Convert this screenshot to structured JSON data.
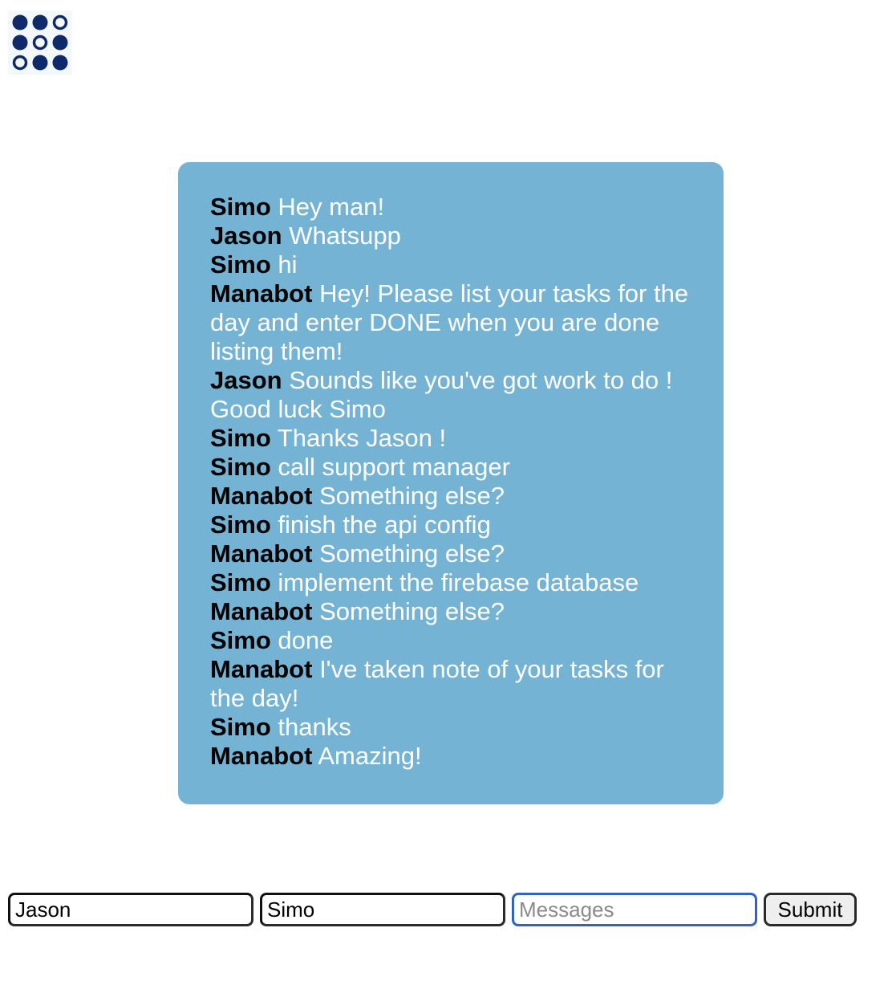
{
  "logo": {
    "icon": "dot-grid-logo",
    "color": "#0f2a6b",
    "pattern": [
      [
        1,
        1,
        0
      ],
      [
        1,
        0,
        1
      ],
      [
        0,
        1,
        1
      ]
    ]
  },
  "chat": {
    "background": "#74b3d4",
    "messages": [
      {
        "author": "Simo",
        "text": "Hey man!"
      },
      {
        "author": "Jason",
        "text": "Whatsupp"
      },
      {
        "author": "Simo",
        "text": "hi"
      },
      {
        "author": "Manabot",
        "text": "Hey! Please list your tasks for the day and enter DONE when you are done listing them!"
      },
      {
        "author": "Jason",
        "text": "Sounds like you've got work to do ! Good luck Simo"
      },
      {
        "author": "Simo",
        "text": "Thanks Jason !"
      },
      {
        "author": "Simo",
        "text": "call support manager"
      },
      {
        "author": "Manabot",
        "text": "Something else?"
      },
      {
        "author": "Simo",
        "text": "finish the api config"
      },
      {
        "author": "Manabot",
        "text": "Something else?"
      },
      {
        "author": "Simo",
        "text": "implement the firebase database"
      },
      {
        "author": "Manabot",
        "text": "Something else?"
      },
      {
        "author": "Simo",
        "text": "done"
      },
      {
        "author": "Manabot",
        "text": "I've taken note of your tasks for the day!"
      },
      {
        "author": "Simo",
        "text": "thanks"
      },
      {
        "author": "Manabot",
        "text": "Amazing!"
      }
    ]
  },
  "form": {
    "sender_value": "Jason",
    "receiver_value": "Simo",
    "message_value": "",
    "message_placeholder": "Messages",
    "submit_label": "Submit"
  }
}
